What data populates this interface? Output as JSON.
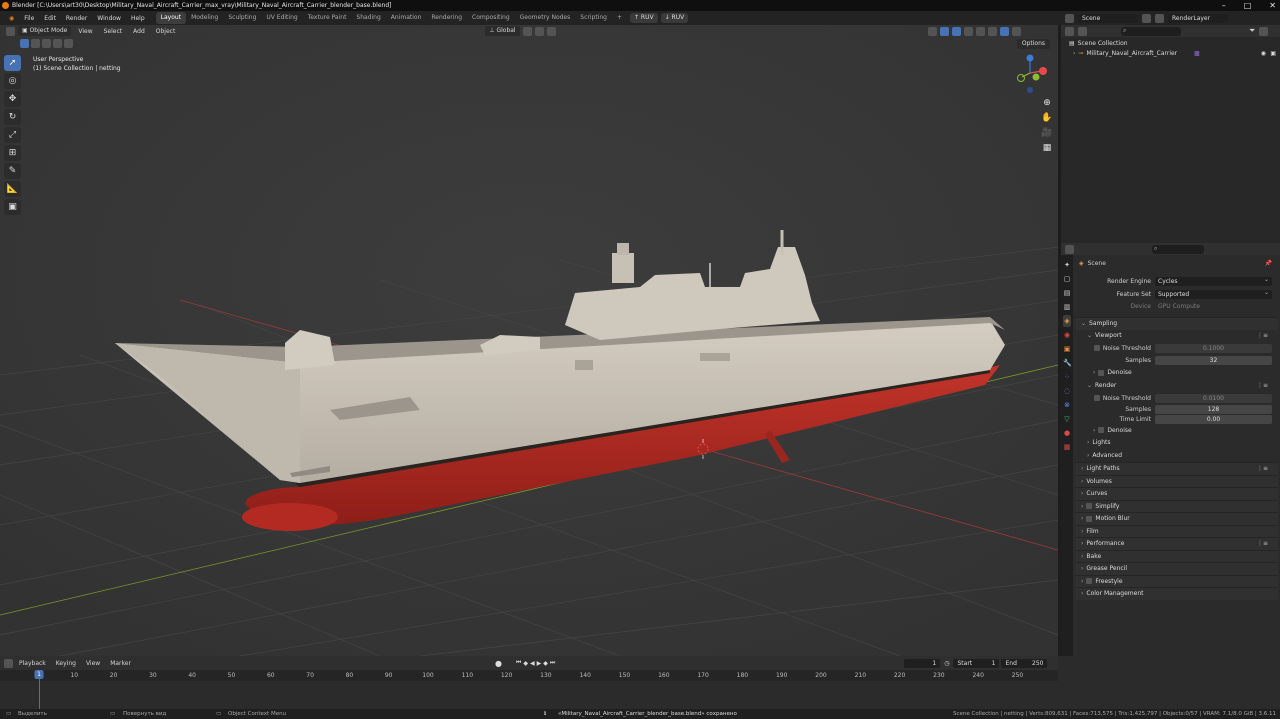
{
  "window": {
    "title": "Blender [C:\\Users\\art30\\Desktop\\Military_Naval_Aircraft_Carrier_max_vray\\Military_Naval_Aircraft_Carrier_blender_base.blend]",
    "controls": [
      "–",
      "□",
      "✕"
    ]
  },
  "menu": [
    "File",
    "Edit",
    "Render",
    "Window",
    "Help"
  ],
  "workspaces": [
    {
      "label": "Layout",
      "active": true
    },
    {
      "label": "Modeling"
    },
    {
      "label": "Sculpting"
    },
    {
      "label": "UV Editing"
    },
    {
      "label": "Texture Paint"
    },
    {
      "label": "Shading"
    },
    {
      "label": "Animation"
    },
    {
      "label": "Rendering"
    },
    {
      "label": "Compositing"
    },
    {
      "label": "Geometry Nodes"
    },
    {
      "label": "Scripting"
    }
  ],
  "topbar_extras": {
    "add_ws": "+",
    "ruv1": "RUV",
    "ruv2": "RUV"
  },
  "scene_selector": {
    "scene": "Scene",
    "view_layer": "RenderLayer"
  },
  "viewport": {
    "mode": "Object Mode",
    "menus": [
      "View",
      "Select",
      "Add",
      "Object"
    ],
    "orientation": "Global",
    "options": "Options",
    "info_line1": "User Perspective",
    "info_line2": "(1) Scene Collection | netting"
  },
  "outliner": {
    "root": "Scene Collection",
    "items": [
      "Military_Naval_Aircraft_Carrier"
    ]
  },
  "properties": {
    "context": "Scene",
    "render_engine_label": "Render Engine",
    "render_engine": "Cycles",
    "feature_set_label": "Feature Set",
    "feature_set": "Supported",
    "device_label": "Device",
    "device": "GPU Compute",
    "sampling": "Sampling",
    "viewport_sub": "Viewport",
    "noise_threshold_label": "Noise Threshold",
    "vp_noise_threshold": "0.1000",
    "samples_label": "Samples",
    "vp_samples": "32",
    "denoise": "Denoise",
    "render_sub": "Render",
    "r_noise_threshold": "0.0100",
    "r_samples": "128",
    "time_limit_label": "Time Limit",
    "r_time_limit": "0.00",
    "denoise2": "Denoise",
    "lights": "Lights",
    "advanced": "Advanced",
    "panels": [
      "Light Paths",
      "Volumes",
      "Curves",
      "Simplify",
      "Motion Blur",
      "Film",
      "Performance",
      "Bake",
      "Grease Pencil",
      "Freestyle",
      "Color Management"
    ]
  },
  "timeline": {
    "menus": [
      "Playback",
      "Keying",
      "View",
      "Marker"
    ],
    "current_frame": "1",
    "start_label": "Start",
    "start": "1",
    "end_label": "End",
    "end": "250",
    "cursor": "1",
    "ticks": [
      "10",
      "20",
      "30",
      "40",
      "50",
      "60",
      "70",
      "80",
      "90",
      "100",
      "110",
      "120",
      "130",
      "140",
      "150",
      "160",
      "170",
      "180",
      "190",
      "200",
      "210",
      "220",
      "230",
      "240",
      "250"
    ]
  },
  "status": {
    "select": "Выделить",
    "rotate": "Повернуть вид",
    "context_menu": "Object Context Menu",
    "message": "«Military_Naval_Aircraft_Carrier_blender_base.blend» сохранено",
    "stats": "Scene Collection | netting | Verts:809,631 | Faces:713,575 | Tris:1,425,797 | Objects:0/57 | VRAM: 7.1/8.0 GiB | 3.6.11"
  },
  "colors": {
    "accent": "#4772b3",
    "hull_red": "#b32a22",
    "hull_grey": "#c9c2b8",
    "viewport_bg": "#3a3a3a"
  }
}
